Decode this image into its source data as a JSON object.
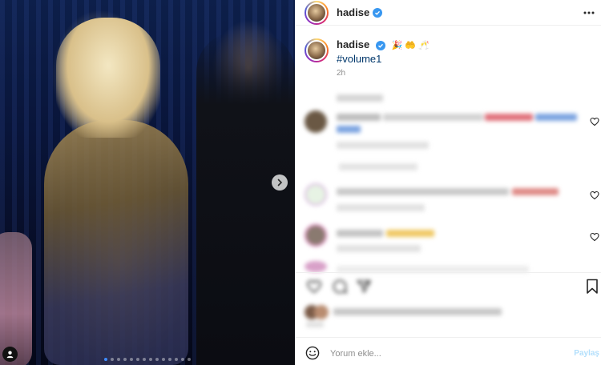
{
  "post": {
    "username": "hadise",
    "caption_emojis": "🎉 🤲 🥂",
    "hashtag": "#volume1",
    "time_ago": "2h"
  },
  "carousel": {
    "dot_count": 14,
    "active_index": 0
  },
  "comment_box": {
    "placeholder": "Yorum ekle...",
    "post_label": "Paylaş"
  },
  "colors": {
    "link": "#00376b",
    "verified": "#3897f0",
    "post_disabled": "#b2dffc"
  },
  "icons": [
    "verified-badge-icon",
    "more-options-icon",
    "heart-icon",
    "comment-icon",
    "share-icon",
    "bookmark-icon",
    "emoji-icon",
    "chevron-right-icon",
    "user-tag-icon"
  ]
}
